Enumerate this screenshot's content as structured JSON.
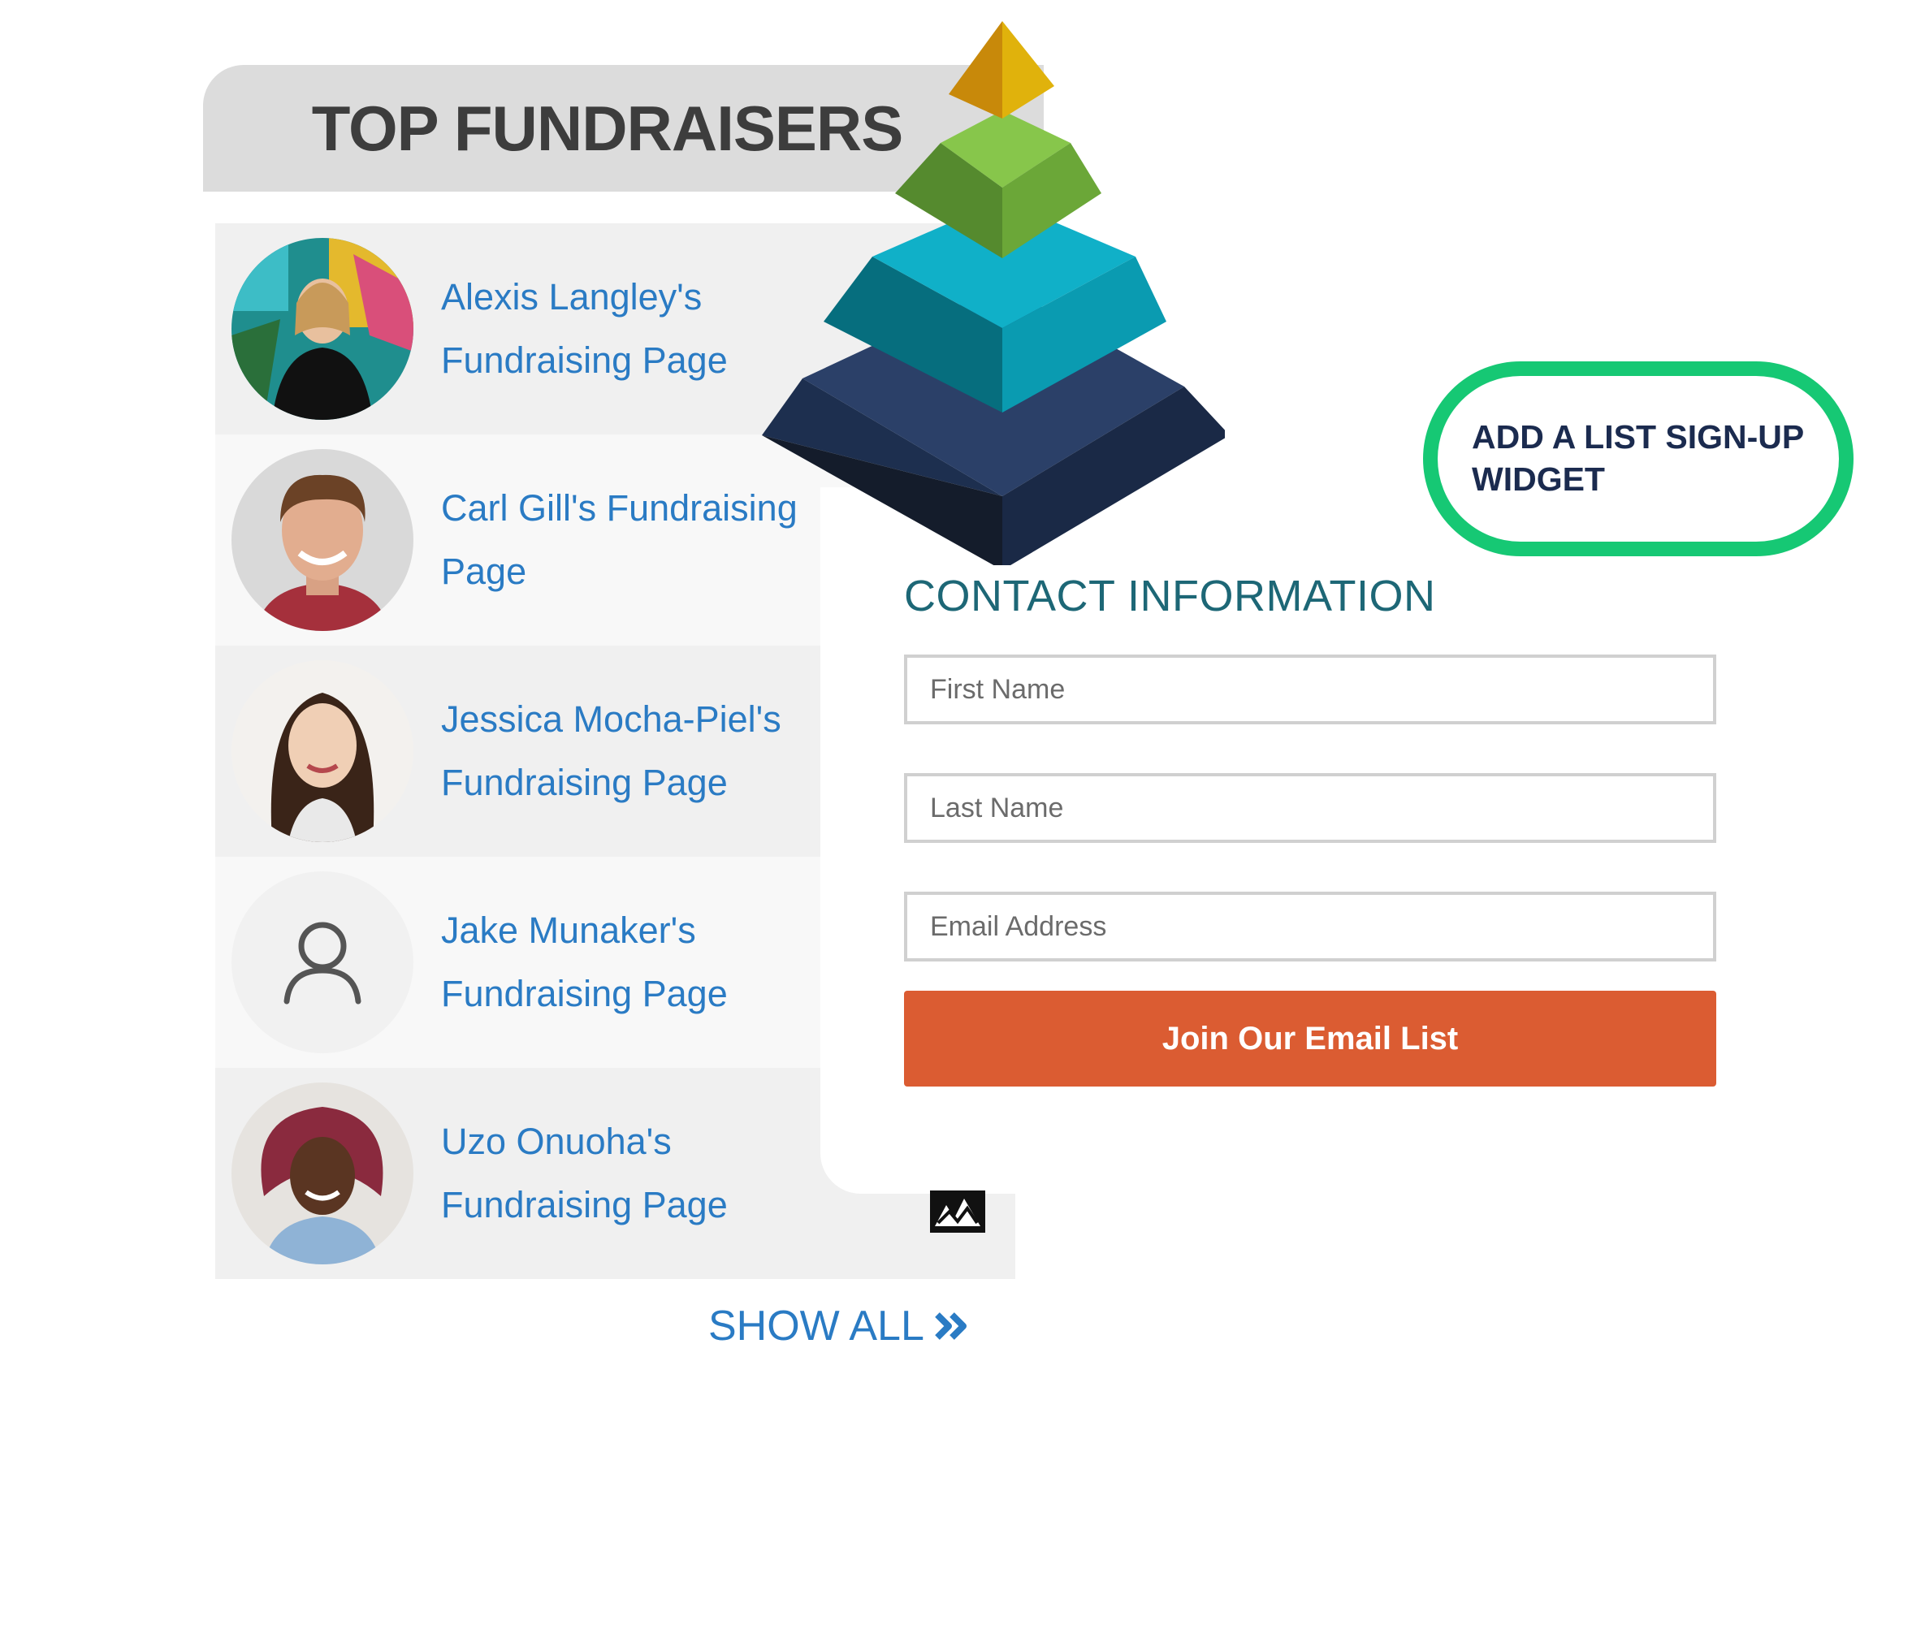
{
  "panel": {
    "title": "TOP FUNDRAISERS",
    "fundraisers": [
      {
        "name": "Alexis Langley's Fundraising Page",
        "avatar": "photo"
      },
      {
        "name": "Carl Gill's Fundraising Page",
        "avatar": "photo"
      },
      {
        "name": "Jessica Mocha-Piel's Fundraising Page",
        "avatar": "photo"
      },
      {
        "name": "Jake Munaker's Fundraising Page",
        "avatar": "user-placeholder-icon"
      },
      {
        "name": "Uzo Onuoha's Fundraising Page",
        "avatar": "photo"
      }
    ],
    "show_all_label": "SHOW ALL"
  },
  "form": {
    "title": "CONTACT INFORMATION",
    "first_name_placeholder": "First Name",
    "last_name_placeholder": "Last Name",
    "email_placeholder": "Email Address",
    "submit_label": "Join Our Email List"
  },
  "callout": {
    "text": "ADD A LIST SIGN-UP WIDGET"
  },
  "colors": {
    "link": "#2a7bc4",
    "header_bg": "#dcdcdc",
    "contact_title": "#1d6776",
    "button": "#db5c32",
    "callout_border": "#16c874",
    "callout_text": "#1b2b4f",
    "pyramid_tiers": [
      "#d4a20a",
      "#7cbf42",
      "#0aa3bb",
      "#24395c"
    ]
  },
  "icons": [
    "chevron-double-right-icon",
    "user-placeholder-icon",
    "pyramid-graphic"
  ]
}
